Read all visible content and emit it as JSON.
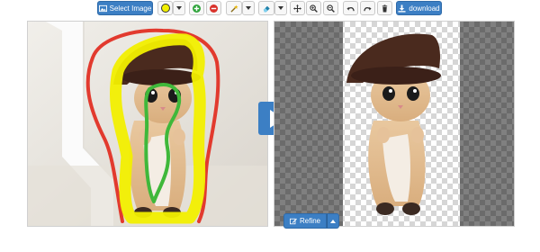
{
  "toolbar": {
    "select_image_label": "Select Image",
    "download_label": "download",
    "icons": [
      "image-icon",
      "brush-color-icon",
      "add-icon",
      "remove-icon",
      "magic-wand-icon",
      "eraser-icon",
      "move-icon",
      "zoom-in-icon",
      "zoom-out-icon",
      "undo-icon",
      "redo-icon",
      "trash-icon",
      "download-icon"
    ]
  },
  "result_panel": {
    "refine_label": "Refine"
  },
  "colors": {
    "accent": "#3c7fc4",
    "marker_yellow": "#f2ef00",
    "marker_red": "#e23a2e",
    "marker_green": "#3fb83a"
  }
}
